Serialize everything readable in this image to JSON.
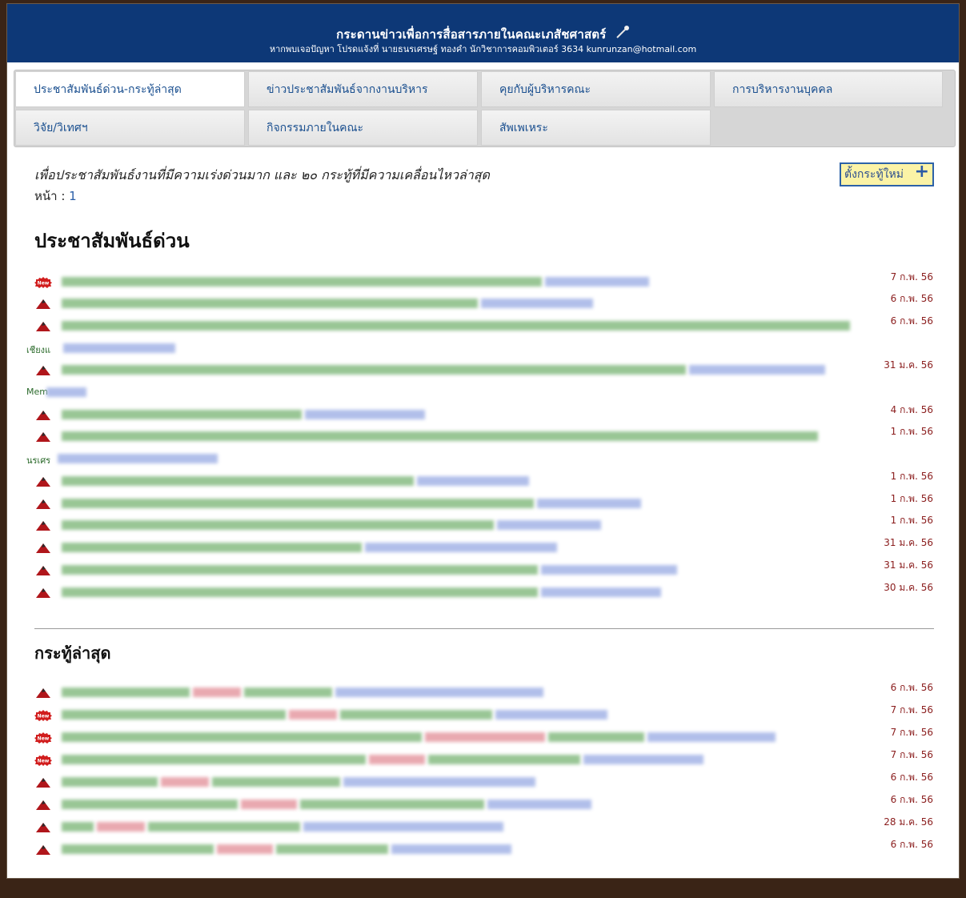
{
  "header": {
    "title": "กระดานข่าวเพื่อการสื่อสารภายในคณะเภสัชศาสตร์",
    "subtitle": "หากพบเจอปัญหา โปรดแจ้งที่ นายธนรเศรษฐ์ ทองคำ นักวิชาการคอมพิวเตอร์ 3634 kunrunzan@hotmail.com",
    "icon": "microphone-icon"
  },
  "tabs": [
    {
      "label": "ประชาสัมพันธ์ด่วน-กระทู้ล่าสุด",
      "active": true
    },
    {
      "label": "ข่าวประชาสัมพันธ์จากงานบริหาร"
    },
    {
      "label": "คุยกับผู้บริหารคณะ"
    },
    {
      "label": "การบริหารงานบุคคล"
    },
    {
      "label": "วิจัย/วิเทศฯ"
    },
    {
      "label": "กิจกรรมภายในคณะ"
    },
    {
      "label": "สัพเพเหระ"
    }
  ],
  "intro": "เพื่อประชาสัมพันธ์งานที่มีความเร่งด่วนมาก และ ๒๐ กระทู้ที่มีความเคลื่อนไหวล่าสุด",
  "page": {
    "label": "หน้า :",
    "number": "1"
  },
  "new_topic_button": "ตั้งกระทู้ใหม่",
  "urgent": {
    "heading": "ประชาสัมพันธ์ด่วน",
    "items": [
      {
        "icon": "new-badge-icon",
        "date": "7 ก.พ. 56",
        "wrap": ""
      },
      {
        "icon": "triangle-icon",
        "date": "6 ก.พ. 56",
        "wrap": ""
      },
      {
        "icon": "triangle-icon",
        "date": "6 ก.พ. 56",
        "wrap": "เชียงแ"
      },
      {
        "icon": "triangle-icon",
        "date": "31 ม.ค. 56",
        "wrap": "Mem"
      },
      {
        "icon": "triangle-icon",
        "date": "4 ก.พ. 56",
        "wrap": ""
      },
      {
        "icon": "triangle-icon",
        "date": "1 ก.พ. 56",
        "wrap": "นรเศร"
      },
      {
        "icon": "triangle-icon",
        "date": "1 ก.พ. 56",
        "wrap": ""
      },
      {
        "icon": "triangle-icon",
        "date": "1 ก.พ. 56",
        "wrap": ""
      },
      {
        "icon": "triangle-icon",
        "date": "1 ก.พ. 56",
        "wrap": ""
      },
      {
        "icon": "triangle-icon",
        "date": "31 ม.ค. 56",
        "wrap": ""
      },
      {
        "icon": "triangle-icon",
        "date": "31 ม.ค. 56",
        "wrap": ""
      },
      {
        "icon": "triangle-icon",
        "date": "30 ม.ค. 56",
        "wrap": ""
      }
    ]
  },
  "latest": {
    "heading": "กระทู้ล่าสุด",
    "items": [
      {
        "icon": "triangle-icon",
        "date": "6 ก.พ. 56"
      },
      {
        "icon": "new-badge-icon",
        "date": "7 ก.พ. 56"
      },
      {
        "icon": "new-badge-icon",
        "date": "7 ก.พ. 56"
      },
      {
        "icon": "new-badge-icon",
        "date": "7 ก.พ. 56"
      },
      {
        "icon": "triangle-icon",
        "date": "6 ก.พ. 56"
      },
      {
        "icon": "triangle-icon",
        "date": "6 ก.พ. 56"
      },
      {
        "icon": "triangle-icon",
        "date": "28 ม.ค. 56"
      },
      {
        "icon": "triangle-icon",
        "date": "6 ก.พ. 56"
      }
    ]
  }
}
